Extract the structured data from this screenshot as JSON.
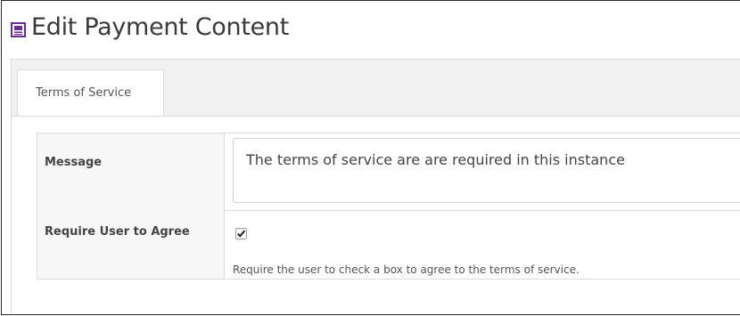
{
  "header": {
    "title": "Edit Payment Content",
    "icon": "document-icon",
    "icon_color": "#6a2c91"
  },
  "tabs": [
    {
      "label": "Terms of Service",
      "active": true
    }
  ],
  "form": {
    "message": {
      "label": "Message",
      "value": "The terms of service are are required in this instance"
    },
    "require_agree": {
      "label": "Require User to Agree",
      "checked": true,
      "help": "Require the user to check a box to agree to the terms of service."
    }
  }
}
